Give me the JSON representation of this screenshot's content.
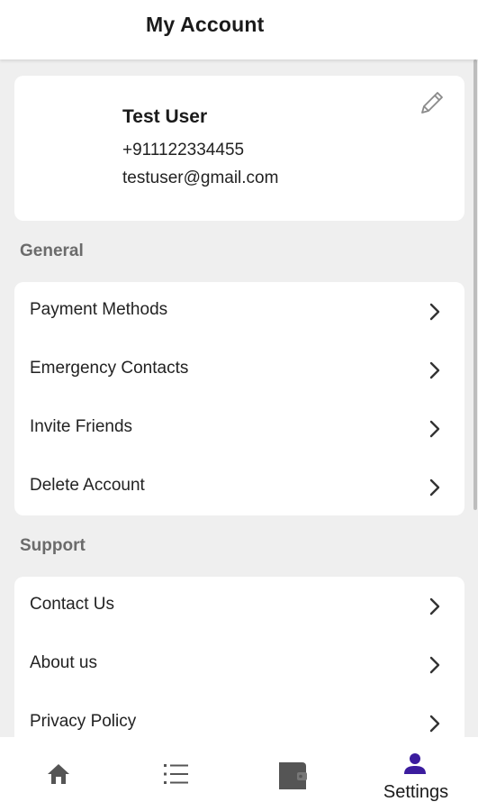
{
  "header": {
    "title": "My Account"
  },
  "profile": {
    "name": "Test User",
    "phone": "+911122334455",
    "email": "testuser@gmail.com",
    "edit_icon": "pencil-icon"
  },
  "general": {
    "title": "General",
    "items": [
      {
        "label": "Payment Methods"
      },
      {
        "label": "Emergency Contacts"
      },
      {
        "label": "Invite Friends"
      },
      {
        "label": "Delete Account"
      }
    ]
  },
  "support": {
    "title": "Support",
    "items": [
      {
        "label": "Contact Us"
      },
      {
        "label": "About us"
      },
      {
        "label": "Privacy Policy"
      }
    ]
  },
  "bottom_nav": {
    "tabs": [
      {
        "icon": "home-icon",
        "label": ""
      },
      {
        "icon": "list-icon",
        "label": ""
      },
      {
        "icon": "wallet-icon",
        "label": ""
      },
      {
        "icon": "person-icon",
        "label": "Settings",
        "active": true
      }
    ]
  },
  "colors": {
    "background": "#efefef",
    "card": "#ffffff",
    "section_title": "#6b6b6b",
    "nav_icon": "#555555",
    "active_accent": "#3b1c9e"
  }
}
